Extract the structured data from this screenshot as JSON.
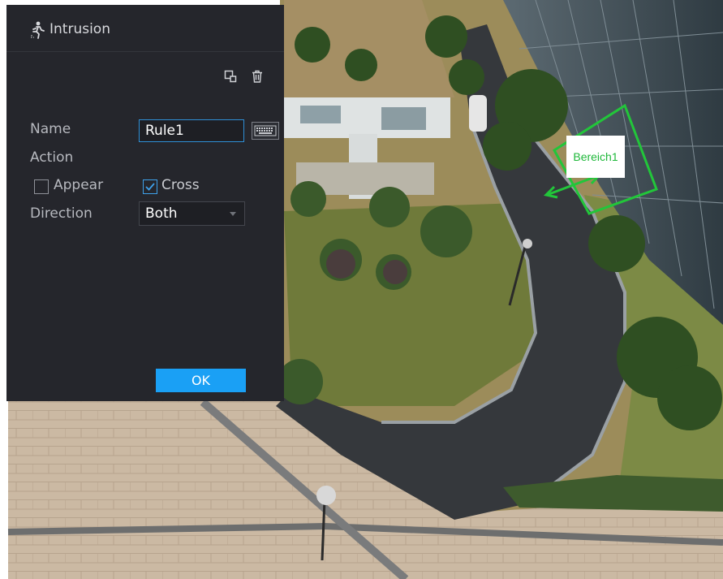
{
  "panel": {
    "title": "Intrusion",
    "title_icon": "running-person-icon",
    "toolbar": {
      "draw_icon": "draw-region-icon",
      "delete_icon": "trash-icon"
    },
    "name_label": "Name",
    "name_value": "Rule1",
    "keyboard_icon": "keyboard-icon",
    "action_label": "Action",
    "appear_label": "Appear",
    "appear_checked": false,
    "cross_label": "Cross",
    "cross_checked": true,
    "direction_label": "Direction",
    "direction_value": "Both",
    "ok_label": "OK"
  },
  "region": {
    "label": "Bereich1",
    "color": "#22c63a"
  },
  "colors": {
    "panel_bg": "#25262c",
    "accent": "#1aa0f5",
    "input_focus_border": "#2f8fd6"
  }
}
